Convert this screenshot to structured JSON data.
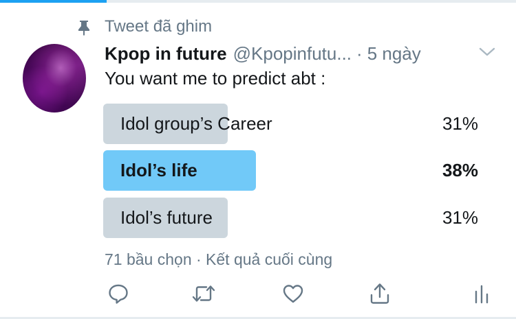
{
  "pinned": {
    "label": "Tweet đã ghim"
  },
  "tweet": {
    "author_name": "Kpop in future",
    "handle": "@Kpopinfutu...",
    "separator": "·",
    "time": "5 ngày",
    "text": "You want me to predict abt :"
  },
  "poll": {
    "options": [
      {
        "label": "Idol group’s Career",
        "percent_text": "31%",
        "percent": 31,
        "winner": false
      },
      {
        "label": "Idol’s life",
        "percent_text": "38%",
        "percent": 38,
        "winner": true
      },
      {
        "label": "Idol’s future",
        "percent_text": "31%",
        "percent": 31,
        "winner": false
      }
    ],
    "meta": "71 bầu chọn · Kết quả cuối cùng"
  },
  "icons": {
    "pin": "pin-icon",
    "caret": "chevron-down-icon",
    "reply": "reply-icon",
    "retweet": "retweet-icon",
    "like": "heart-icon",
    "share": "share-icon",
    "analytics": "analytics-icon"
  },
  "colors": {
    "accent": "#1da1f2",
    "poll_winner": "#71c9f8",
    "poll_default": "#ccd6dd",
    "secondary_text": "#657786",
    "icon": "#657786"
  }
}
